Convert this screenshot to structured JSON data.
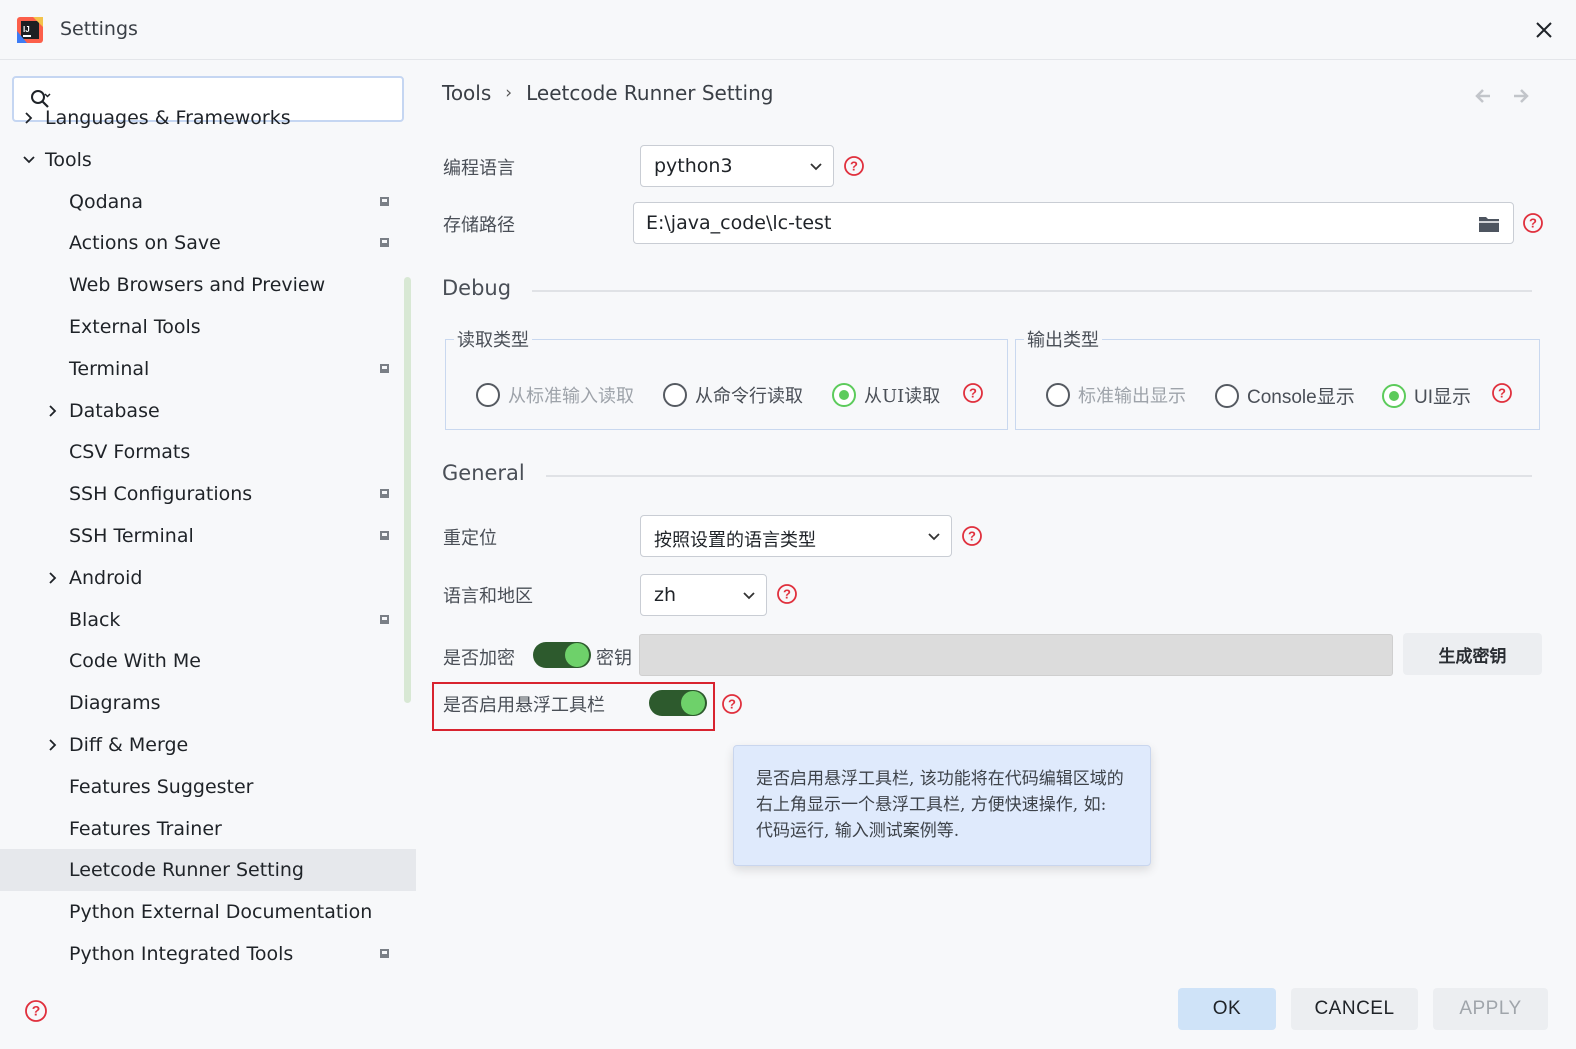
{
  "window": {
    "title": "Settings"
  },
  "sidebar": {
    "search": {
      "value": "",
      "placeholder": ""
    },
    "items": [
      {
        "label": "Languages & Frameworks",
        "indent": 0,
        "chevron": "right"
      },
      {
        "label": "Tools",
        "indent": 0,
        "chevron": "down"
      },
      {
        "label": "Qodana",
        "indent": 1,
        "pin": true
      },
      {
        "label": "Actions on Save",
        "indent": 1,
        "pin": true
      },
      {
        "label": "Web Browsers and Preview",
        "indent": 1
      },
      {
        "label": "External Tools",
        "indent": 1
      },
      {
        "label": "Terminal",
        "indent": 1,
        "pin": true
      },
      {
        "label": "Database",
        "indent": 1,
        "chevron": "right"
      },
      {
        "label": "CSV Formats",
        "indent": 1
      },
      {
        "label": "SSH Configurations",
        "indent": 1,
        "pin": true
      },
      {
        "label": "SSH Terminal",
        "indent": 1,
        "pin": true
      },
      {
        "label": "Android",
        "indent": 1,
        "chevron": "right"
      },
      {
        "label": "Black",
        "indent": 1,
        "pin": true
      },
      {
        "label": "Code With Me",
        "indent": 1
      },
      {
        "label": "Diagrams",
        "indent": 1
      },
      {
        "label": "Diff & Merge",
        "indent": 1,
        "chevron": "right"
      },
      {
        "label": "Features Suggester",
        "indent": 1
      },
      {
        "label": "Features Trainer",
        "indent": 1
      },
      {
        "label": "Leetcode Runner Setting",
        "indent": 1,
        "selected": true
      },
      {
        "label": "Python External Documentation",
        "indent": 1
      },
      {
        "label": "Python Integrated Tools",
        "indent": 1,
        "pin": true
      }
    ]
  },
  "breadcrumb": {
    "parent": "Tools",
    "separator": "›",
    "current": "Leetcode Runner Setting"
  },
  "form": {
    "language": {
      "label": "编程语言",
      "value": "python3"
    },
    "path": {
      "label": "存储路径",
      "value": "E:\\java_code\\lc-test"
    },
    "debug": {
      "title": "Debug",
      "read_type": {
        "title": "读取类型",
        "options": [
          {
            "label": "从标准输入读取",
            "selected": false,
            "disabled": true
          },
          {
            "label": "从命令行读取",
            "selected": false
          },
          {
            "label": "从UI读取",
            "selected": true
          }
        ]
      },
      "output_type": {
        "title": "输出类型",
        "options": [
          {
            "label": "标准输出显示",
            "selected": false,
            "disabled": true
          },
          {
            "label": "Console显示",
            "selected": false
          },
          {
            "label": "UI显示",
            "selected": true
          }
        ]
      }
    },
    "general": {
      "title": "General",
      "relocate": {
        "label": "重定位",
        "value": "按照设置的语言类型"
      },
      "locale": {
        "label": "语言和地区",
        "value": "zh"
      },
      "encrypt": {
        "label": "是否加密",
        "key_label": "密钥",
        "enabled": true,
        "generate_button": "生成密钥"
      },
      "floating_toolbar": {
        "label": "是否启用悬浮工具栏",
        "enabled": true
      },
      "tooltip": "是否启用悬浮工具栏, 该功能将在代码编辑区域的右上角显示一个悬浮工具栏, 方便快速操作, 如: 代码运行, 输入测试案例等."
    }
  },
  "footer": {
    "ok": "OK",
    "cancel": "CANCEL",
    "apply": "APPLY"
  },
  "colors": {
    "accent_green": "#5ccb5b",
    "help_red": "#e0303d",
    "highlight_red": "#d8232f",
    "ok_button": "#cfe3f8"
  }
}
